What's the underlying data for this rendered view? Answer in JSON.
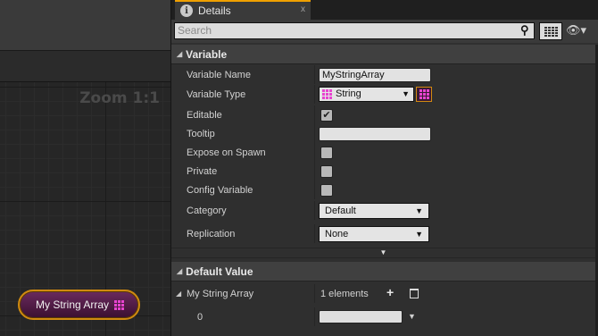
{
  "graph": {
    "zoom_label": "Zoom 1:1",
    "node_label": "My String Array"
  },
  "details": {
    "tab_title": "Details",
    "tab_close": "x",
    "search_placeholder": "Search",
    "sections": {
      "variable": "Variable",
      "default_value": "Default Value"
    },
    "fields": {
      "variable_name": {
        "label": "Variable Name",
        "value": "MyStringArray"
      },
      "variable_type": {
        "label": "Variable Type",
        "value": "String"
      },
      "editable": {
        "label": "Editable",
        "checked": true
      },
      "tooltip": {
        "label": "Tooltip",
        "value": ""
      },
      "expose_on_spawn": {
        "label": "Expose on Spawn",
        "checked": false
      },
      "private": {
        "label": "Private",
        "checked": false
      },
      "config_variable": {
        "label": "Config Variable",
        "checked": false
      },
      "category": {
        "label": "Category",
        "value": "Default"
      },
      "replication": {
        "label": "Replication",
        "value": "None"
      }
    },
    "default_value": {
      "array_label": "My String Array",
      "count_text": "1 elements",
      "element_index": "0",
      "element_value": ""
    }
  },
  "colors": {
    "accent_tab": "#f0a000",
    "string_pin": "#e844d0",
    "node_border": "#d08a10"
  },
  "icons": {
    "tab": "info-icon",
    "search": "search-icon",
    "view_options": "eye-icon",
    "add": "plus-icon",
    "remove": "trash-icon"
  }
}
